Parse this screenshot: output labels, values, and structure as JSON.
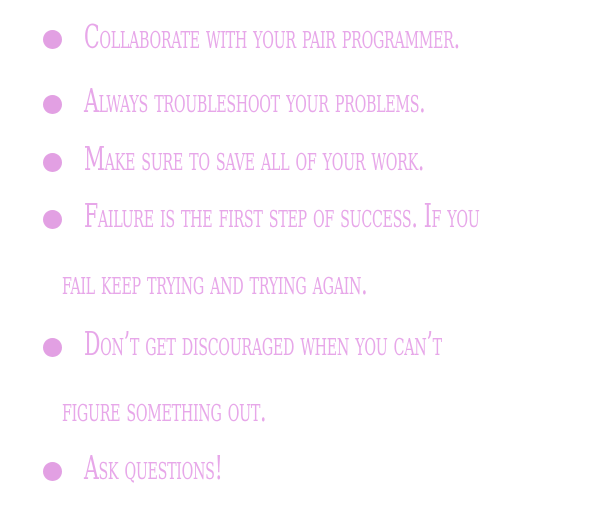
{
  "bullets": [
    {
      "lines": [
        "Collaborate with your pair programmer."
      ]
    },
    {
      "lines": [
        "Always troubleshoot your problems."
      ]
    },
    {
      "lines": [
        "Make sure to save all of your work."
      ]
    },
    {
      "lines": [
        "Failure is the first step of success. If you",
        "fail keep trying and trying again."
      ]
    },
    {
      "lines": [
        "Don’t get discouraged when you can’t",
        "figure something out."
      ]
    },
    {
      "lines": [
        "Ask questions!"
      ]
    }
  ],
  "colors": {
    "text": "#e7a7e9",
    "bullet": "#e2a0e3",
    "background": "#ffffff"
  }
}
